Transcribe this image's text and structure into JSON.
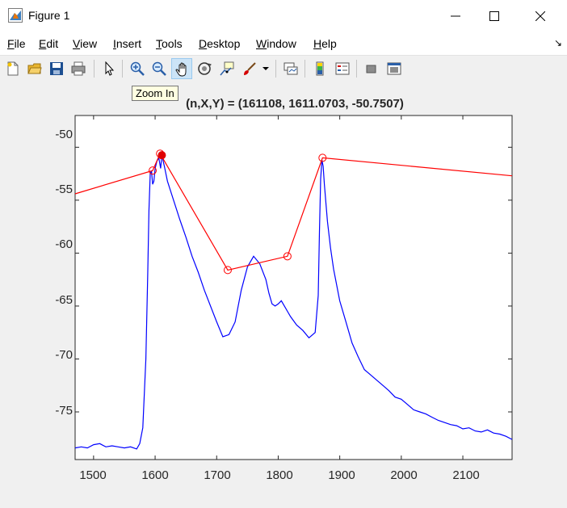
{
  "window": {
    "title": "Figure 1"
  },
  "menu": [
    {
      "key": "F",
      "rest": "ile"
    },
    {
      "key": "E",
      "rest": "dit"
    },
    {
      "key": "V",
      "rest": "iew"
    },
    {
      "key": "I",
      "rest": "nsert"
    },
    {
      "key": "T",
      "rest": "ools"
    },
    {
      "key": "D",
      "rest": "esktop"
    },
    {
      "key": "W",
      "rest": "indow"
    },
    {
      "key": "H",
      "rest": "elp"
    }
  ],
  "toolbar": {
    "icons": [
      "new-figure-icon",
      "open-file-icon",
      "save-icon",
      "print-icon",
      "edit-plot-icon",
      "zoom-in-icon",
      "zoom-out-icon",
      "pan-icon",
      "rotate-3d-icon",
      "data-cursor-icon",
      "brush-icon",
      "link-plot-icon",
      "colorbar-icon",
      "legend-icon",
      "hide-plot-tools-icon",
      "show-plot-tools-icon"
    ],
    "active": "pan-icon",
    "tooltip": "Zoom In"
  },
  "axes": {
    "title": "(n,X,Y) = (161108, 1611.0703, -50.7507)",
    "yticks": [
      "-50",
      "-55",
      "-60",
      "-65",
      "-70",
      "-75"
    ],
    "xticks": [
      "1500",
      "1600",
      "1700",
      "1800",
      "1900",
      "2000",
      "2100"
    ]
  },
  "colors": {
    "blue_trace": "#0000ff",
    "red_trace": "#ff0000",
    "marker": "#e00000"
  },
  "chart_data": {
    "type": "line",
    "xlim": [
      1470,
      2180
    ],
    "ylim": [
      -79.5,
      -47
    ],
    "grid": false,
    "series": [
      {
        "color": "blue",
        "x": [
          1470,
          1480,
          1490,
          1500,
          1510,
          1520,
          1530,
          1540,
          1550,
          1560,
          1570,
          1575,
          1580,
          1585,
          1588,
          1590,
          1592,
          1594,
          1596,
          1598,
          1600,
          1603,
          1606,
          1609,
          1611,
          1615,
          1620,
          1630,
          1640,
          1650,
          1660,
          1670,
          1680,
          1690,
          1700,
          1710,
          1720,
          1730,
          1740,
          1750,
          1760,
          1770,
          1780,
          1785,
          1790,
          1795,
          1800,
          1805,
          1810,
          1815,
          1820,
          1830,
          1840,
          1850,
          1860,
          1865,
          1867,
          1869,
          1871,
          1873,
          1875,
          1880,
          1885,
          1890,
          1900,
          1910,
          1920,
          1930,
          1940,
          1950,
          1960,
          1970,
          1980,
          1990,
          2000,
          2010,
          2020,
          2030,
          2040,
          2050,
          2060,
          2070,
          2080,
          2090,
          2100,
          2110,
          2120,
          2130,
          2140,
          2150,
          2160,
          2170,
          2180
        ],
        "y": [
          -78.4,
          -78.3,
          -78.4,
          -78.1,
          -78.0,
          -78.3,
          -78.2,
          -78.3,
          -78.4,
          -78.3,
          -78.5,
          -78.0,
          -76.5,
          -70.0,
          -62.0,
          -56.0,
          -52.5,
          -52.2,
          -53.5,
          -53.2,
          -52.0,
          -51.3,
          -51.0,
          -52.0,
          -50.75,
          -51.8,
          -53.2,
          -55.0,
          -56.8,
          -58.5,
          -60.3,
          -61.8,
          -63.5,
          -65.0,
          -66.5,
          -67.9,
          -67.7,
          -66.5,
          -63.5,
          -61.3,
          -60.3,
          -61.0,
          -62.5,
          -63.8,
          -64.8,
          -65.0,
          -64.8,
          -64.5,
          -65.0,
          -65.5,
          -66.0,
          -66.8,
          -67.3,
          -68.0,
          -67.5,
          -64.0,
          -58.0,
          -53.0,
          -51.2,
          -51.8,
          -53.5,
          -57.0,
          -59.5,
          -61.5,
          -64.5,
          -66.5,
          -68.5,
          -69.8,
          -71.0,
          -71.5,
          -72.0,
          -72.5,
          -73.0,
          -73.6,
          -73.8,
          -74.3,
          -74.8,
          -75.0,
          -75.2,
          -75.5,
          -75.8,
          -76.0,
          -76.2,
          -76.3,
          -76.6,
          -76.5,
          -76.8,
          -76.9,
          -76.7,
          -77.0,
          -77.1,
          -77.3,
          -77.6
        ]
      },
      {
        "color": "red",
        "x": [
          1470,
          1596,
          1608,
          1718,
          1815,
          1872,
          2180
        ],
        "y": [
          -54.4,
          -52.2,
          -50.6,
          -61.6,
          -60.3,
          -51.0,
          -52.7
        ]
      }
    ],
    "markers_open": [
      [
        1596,
        -52.2
      ],
      [
        1608,
        -50.6
      ],
      [
        1718,
        -61.6
      ],
      [
        1815,
        -60.3
      ],
      [
        1872,
        -51.0
      ]
    ],
    "marker_selected": [
      1611,
      -50.75
    ]
  }
}
